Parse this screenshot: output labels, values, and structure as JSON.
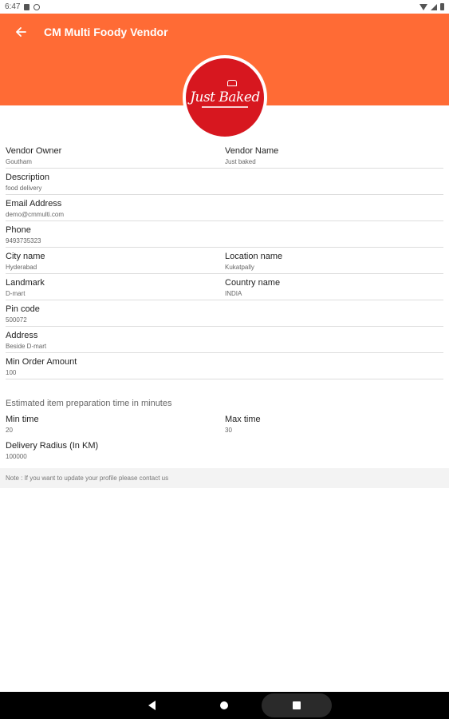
{
  "status_bar": {
    "time": "6:47"
  },
  "app_bar": {
    "title": "CM Multi Foody Vendor"
  },
  "logo": {
    "text": "Just Baked"
  },
  "fields": {
    "vendor_owner": {
      "label": "Vendor Owner",
      "value": "Goutham"
    },
    "vendor_name": {
      "label": "Vendor Name",
      "value": "Just baked"
    },
    "description": {
      "label": "Description",
      "value": "food delivery"
    },
    "email": {
      "label": "Email Address",
      "value": "demo@cmmulti.com"
    },
    "phone": {
      "label": "Phone",
      "value": "9493735323"
    },
    "city": {
      "label": "City name",
      "value": "Hyderabad"
    },
    "location": {
      "label": "Location name",
      "value": "Kukatpally"
    },
    "landmark": {
      "label": "Landmark",
      "value": "D-mart"
    },
    "country": {
      "label": "Country name",
      "value": "INDIA"
    },
    "pin": {
      "label": "Pin code",
      "value": "500072"
    },
    "address": {
      "label": "Address",
      "value": "Beside D-mart"
    },
    "min_order": {
      "label": "Min Order Amount",
      "value": "100"
    }
  },
  "prep_time": {
    "heading": "Estimated item preparation time in minutes",
    "min": {
      "label": "Min time",
      "value": "20"
    },
    "max": {
      "label": "Max time",
      "value": "30"
    }
  },
  "delivery": {
    "label": "Delivery Radius (In KM)",
    "value": "100000"
  },
  "note": "Note : If you want to update your profile please contact us",
  "colors": {
    "primary": "#ff6b35",
    "logo_bg": "#d7171f"
  }
}
